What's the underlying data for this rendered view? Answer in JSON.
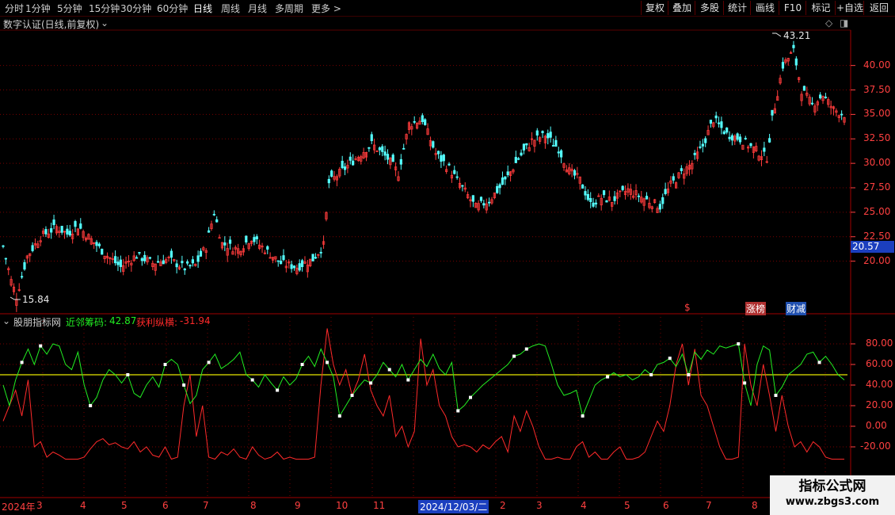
{
  "toolbar": {
    "periods": [
      "分时",
      "1分钟",
      "5分钟",
      "15分钟",
      "30分钟",
      "60分钟",
      "日线",
      "周线",
      "月线",
      "多周期",
      "更多 >"
    ],
    "active_period": "日线",
    "buttons": [
      "复权",
      "叠加",
      "多股",
      "统计",
      "画线",
      "F10",
      "标记",
      "+自选",
      "返回"
    ]
  },
  "main_panel": {
    "title": "数字认证(日线,前复权)",
    "high_label": "43.21",
    "low_label": "15.84",
    "current_price": "20.57",
    "price_ticks": [
      "40.00",
      "37.50",
      "35.00",
      "32.50",
      "30.00",
      "27.50",
      "25.00",
      "22.50",
      "20.00"
    ],
    "markers": {
      "dollar": "$",
      "limit_board": "涨榜",
      "finance": "财减"
    }
  },
  "indicator_panel": {
    "name": "股朋指标网",
    "line1_label": "近邻筹码:",
    "line1_value": "42.87",
    "line2_label": "获利纵横:",
    "line2_value": "-31.94",
    "ticks": [
      "80.00",
      "60.00",
      "40.00",
      "20.00",
      "0.00",
      "-20.00"
    ],
    "ref_level": 50
  },
  "time_axis": {
    "labels": [
      "2024年",
      "3",
      "4",
      "5",
      "6",
      "7",
      "8",
      "9",
      "10",
      "11",
      "2024/12/03/二",
      "2",
      "3",
      "4",
      "5",
      "6",
      "7",
      "8",
      "9"
    ]
  },
  "watermark": {
    "line1": "指标公式网",
    "line2": "www.zbgs3.com"
  },
  "colors": {
    "up": "#ff3c3c",
    "down": "#54ffff",
    "green_line": "#22ee22",
    "red_line": "#ff2a2a",
    "ref_line": "#e6e600",
    "grid": "#7a0000"
  },
  "chart_data": {
    "type": "candlestick",
    "price_range": [
      15.84,
      43.21
    ],
    "series": [
      {
        "name": "近邻筹码",
        "last": 42.87
      },
      {
        "name": "获利纵横",
        "last": -31.94
      }
    ]
  }
}
